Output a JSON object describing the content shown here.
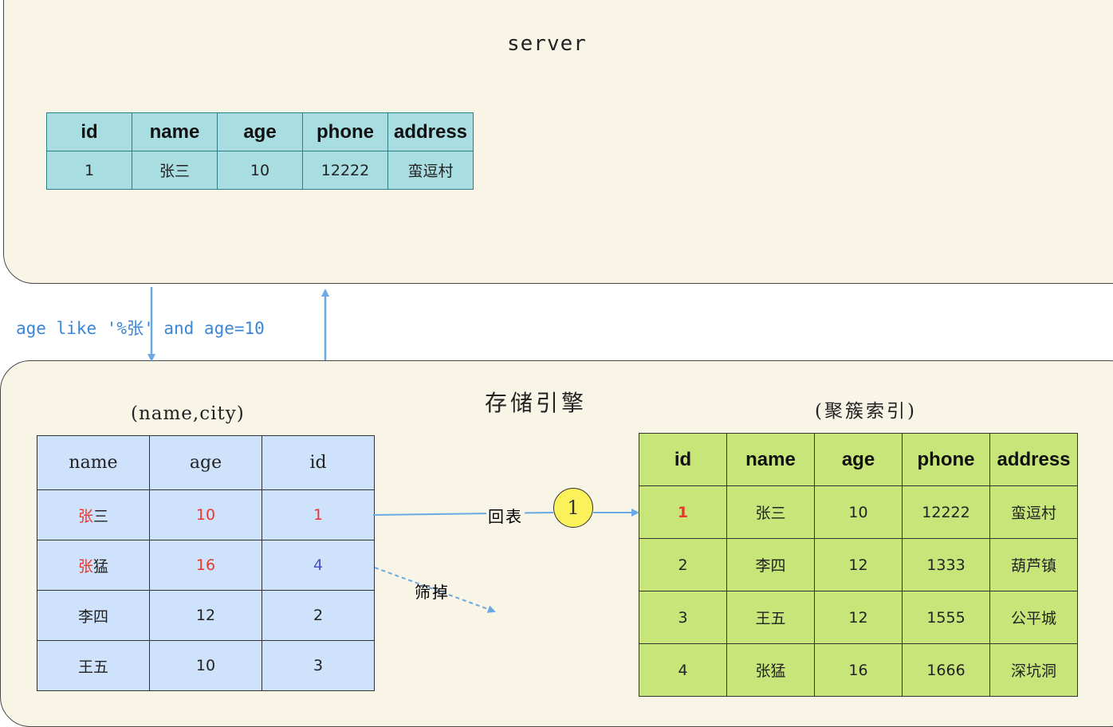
{
  "server": {
    "title": "server",
    "table": {
      "headers": [
        "id",
        "name",
        "age",
        "phone",
        "address"
      ],
      "rows": [
        [
          "1",
          "张三",
          "10",
          "12222",
          "蛮逗村"
        ]
      ]
    }
  },
  "query_label": "age like '%张' and age=10",
  "engine": {
    "title": "存储引擎",
    "index_title": "(name,city)",
    "index_table": {
      "headers": [
        "name",
        "age",
        "id"
      ],
      "rows": [
        {
          "name_hl": "张",
          "name_rest": "三",
          "age": "10",
          "id": "1"
        },
        {
          "name_hl": "张",
          "name_rest": "猛",
          "age": "16",
          "id": "4"
        },
        {
          "name_hl": "",
          "name_rest": "李四",
          "age": "12",
          "id": "2"
        },
        {
          "name_hl": "",
          "name_rest": "王五",
          "age": "10",
          "id": "3"
        }
      ]
    },
    "cluster_title": "(聚簇索引)",
    "cluster_table": {
      "headers": [
        "id",
        "name",
        "age",
        "phone",
        "address"
      ],
      "rows": [
        [
          "1",
          "张三",
          "10",
          "12222",
          "蛮逗村"
        ],
        [
          "2",
          "李四",
          "12",
          "1333",
          "葫芦镇"
        ],
        [
          "3",
          "王五",
          "12",
          "1555",
          "公平城"
        ],
        [
          "4",
          "张猛",
          "16",
          "1666",
          "深坑洞"
        ]
      ]
    },
    "lookup_label": "回表",
    "lookup_step": "1",
    "filter_label": "筛掉"
  },
  "colors": {
    "panel_bg": "#f8f5e7",
    "server_table": "#a8dde2",
    "index_table": "#cfe2fb",
    "cluster_table": "#c8e57a",
    "arrow": "#6aa8e6",
    "highlight_red": "#e8382e",
    "highlight_blue": "#4a52c8"
  }
}
